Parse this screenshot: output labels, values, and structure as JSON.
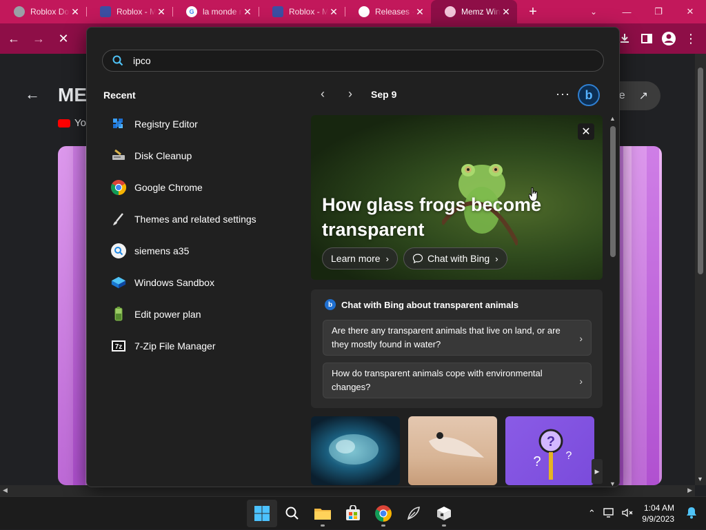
{
  "browser": {
    "tabs": [
      {
        "title": "Roblox Dov",
        "icon": "roblox-avatar-icon",
        "active": false
      },
      {
        "title": "Roblox - M",
        "icon": "roblox-logo-icon",
        "active": false
      },
      {
        "title": "la monde m",
        "icon": "google-g-icon",
        "active": false
      },
      {
        "title": "Roblox - M",
        "icon": "roblox-logo-icon",
        "active": false
      },
      {
        "title": "Releases · T",
        "icon": "github-icon",
        "active": false
      },
      {
        "title": "Memz Win",
        "icon": "memz-icon",
        "active": true
      }
    ],
    "tab_close_glyph": "✕",
    "new_tab_glyph": "+",
    "accent_color": "#c2185b",
    "toolbar_color": "#8e0e47"
  },
  "page_behind": {
    "title": "ME",
    "channel": "Yo",
    "share_label": "e"
  },
  "search": {
    "query": "ipco"
  },
  "recent": {
    "heading": "Recent",
    "items": [
      {
        "label": "Registry Editor",
        "icon": "registry-editor-icon"
      },
      {
        "label": "Disk Cleanup",
        "icon": "disk-cleanup-icon"
      },
      {
        "label": "Google Chrome",
        "icon": "chrome-icon"
      },
      {
        "label": "Themes and related settings",
        "icon": "brush-icon"
      },
      {
        "label": "siemens a35",
        "icon": "web-search-icon"
      },
      {
        "label": "Windows Sandbox",
        "icon": "windows-sandbox-icon"
      },
      {
        "label": "Edit power plan",
        "icon": "power-plan-icon"
      },
      {
        "label": "7-Zip File Manager",
        "icon": "7zip-icon"
      }
    ]
  },
  "feed": {
    "date": "Sep 9",
    "more_glyph": "···",
    "hero": {
      "title": "How glass frogs become transparent",
      "learn_more": "Learn more",
      "chat_with_bing": "Chat with Bing"
    },
    "chat_card": {
      "heading": "Chat with Bing about transparent animals",
      "questions": [
        "Are there any transparent animals that live on land, or are they mostly found in water?",
        "How do transparent animals cope with environmental changes?"
      ]
    }
  },
  "taskbar": {
    "time": "1:04 AM",
    "date": "9/9/2023"
  }
}
